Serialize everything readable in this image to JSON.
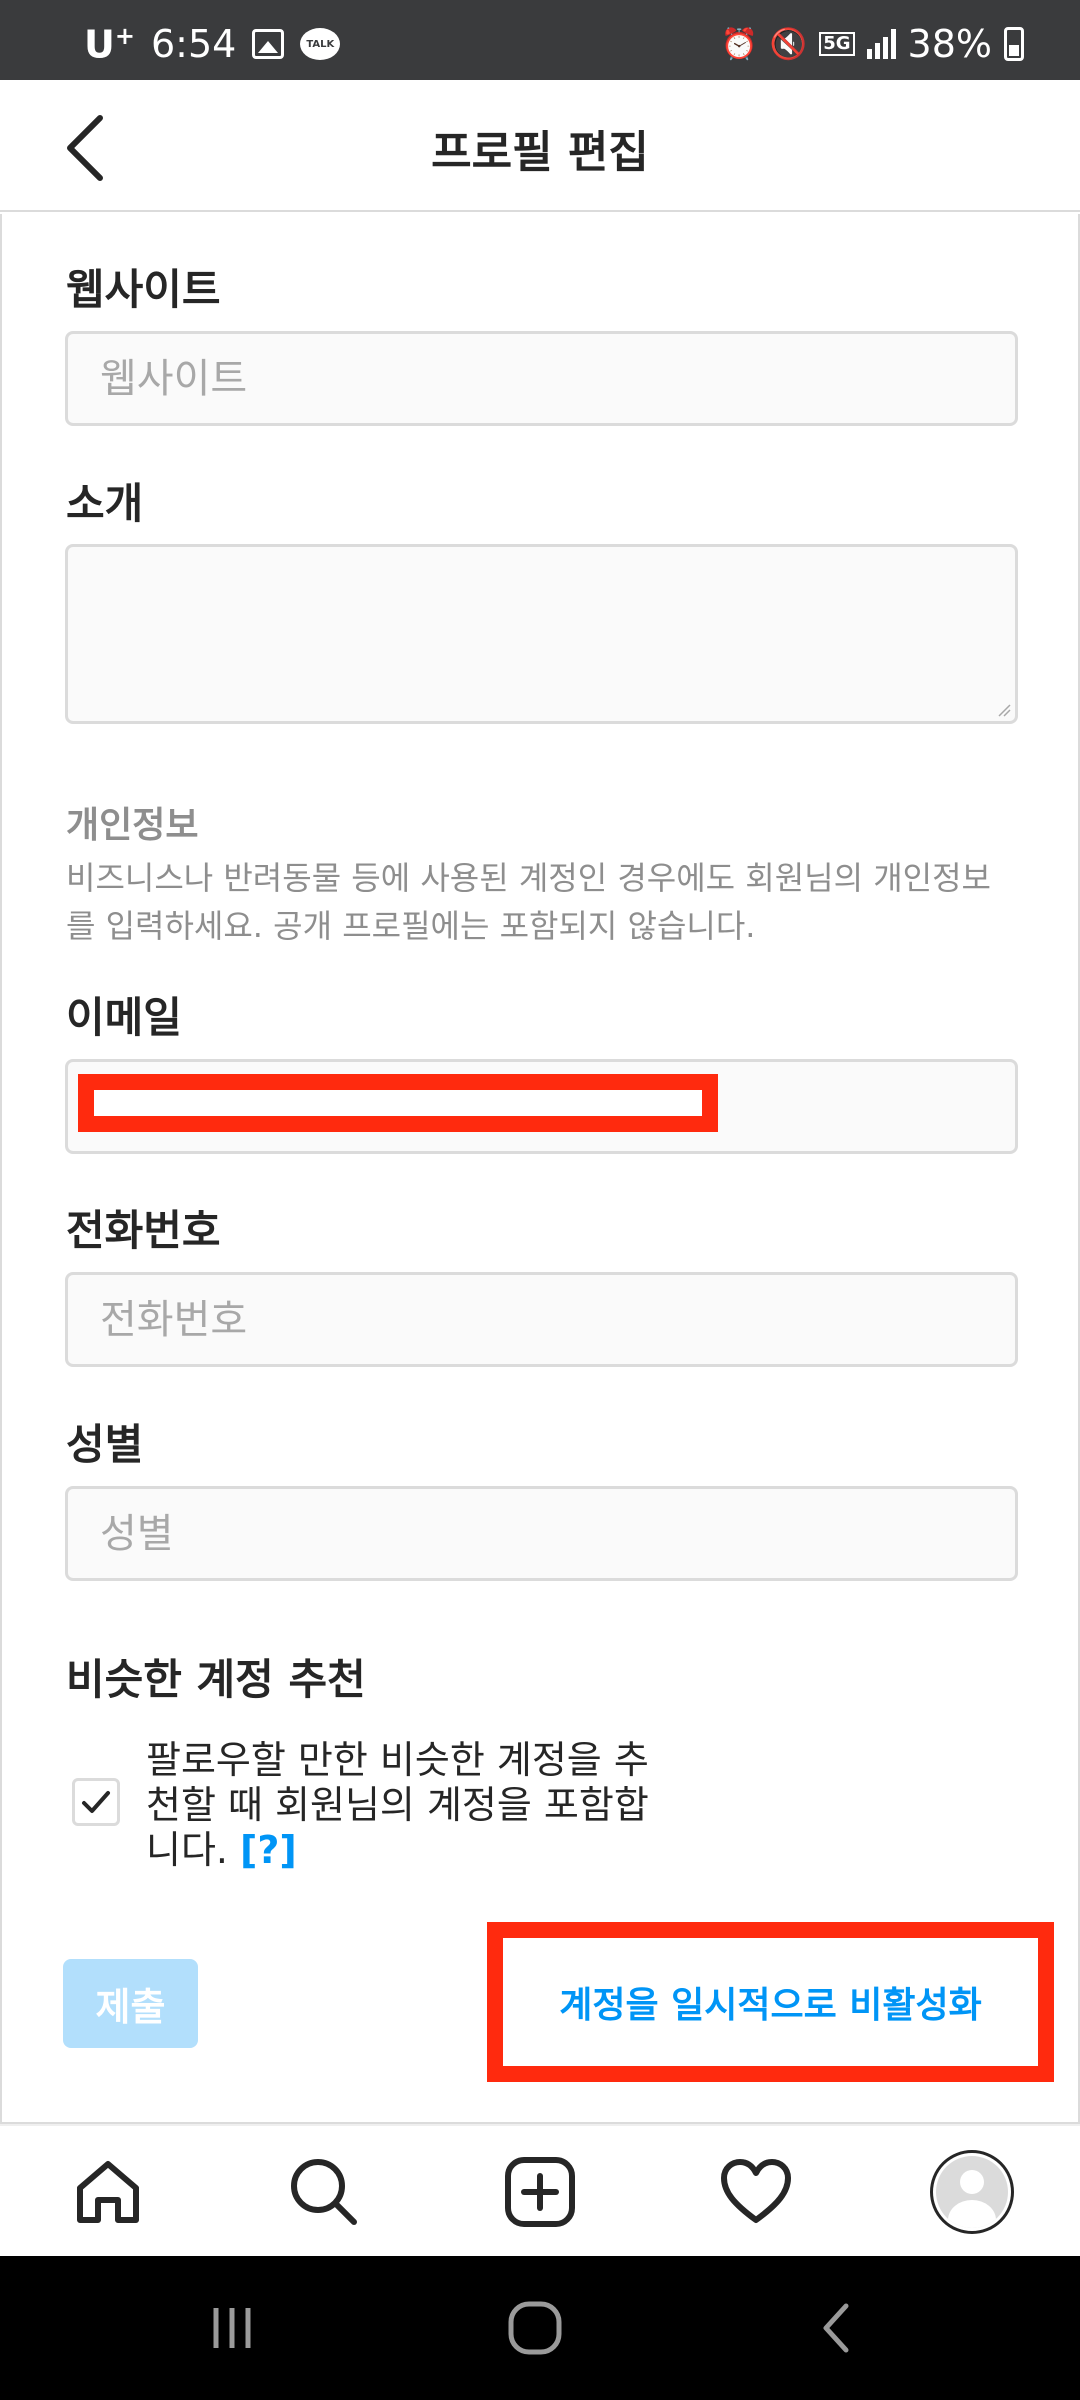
{
  "status_bar": {
    "carrier": "U",
    "carrier_sup": "+",
    "time": "6:54",
    "talk_badge": "TALK",
    "network": "5G",
    "battery": "38%"
  },
  "header": {
    "title": "프로필 편집",
    "back_icon": "chevron-left-icon"
  },
  "form": {
    "website": {
      "label": "웹사이트",
      "placeholder": "웹사이트",
      "value": ""
    },
    "bio": {
      "label": "소개",
      "value": ""
    },
    "private_info": {
      "heading": "개인정보",
      "description": "비즈니스나 반려동물 등에 사용된 계정인 경우에도 회원님의 개인정보를 입력하세요. 공개 프로필에는 포함되지 않습니다."
    },
    "email": {
      "label": "이메일",
      "value": ""
    },
    "phone": {
      "label": "전화번호",
      "placeholder": "전화번호",
      "value": ""
    },
    "gender": {
      "label": "성별",
      "placeholder": "성별",
      "value": ""
    },
    "suggestions": {
      "label": "비슷한 계정 추천",
      "checkbox_text": "팔로우할 만한 비슷한 계정을 추천할 때 회원님의 계정을 포함합니다.",
      "checked": true,
      "help_link": "[?]"
    },
    "submit_label": "제출",
    "deactivate_label": "계정을 일시적으로 비활성화"
  },
  "bottom_nav": {
    "items": [
      "home-icon",
      "search-icon",
      "create-post-icon",
      "activity-heart-icon",
      "profile-avatar"
    ]
  },
  "system_nav": {
    "items": [
      "recent-apps-icon",
      "home-circle-icon",
      "back-icon"
    ]
  },
  "colors": {
    "accent": "#0095f6",
    "submit_disabled": "#b2dffc",
    "highlight": "#ff2a0e",
    "border": "#dbdbdb",
    "muted_text": "#8e8e8e"
  }
}
